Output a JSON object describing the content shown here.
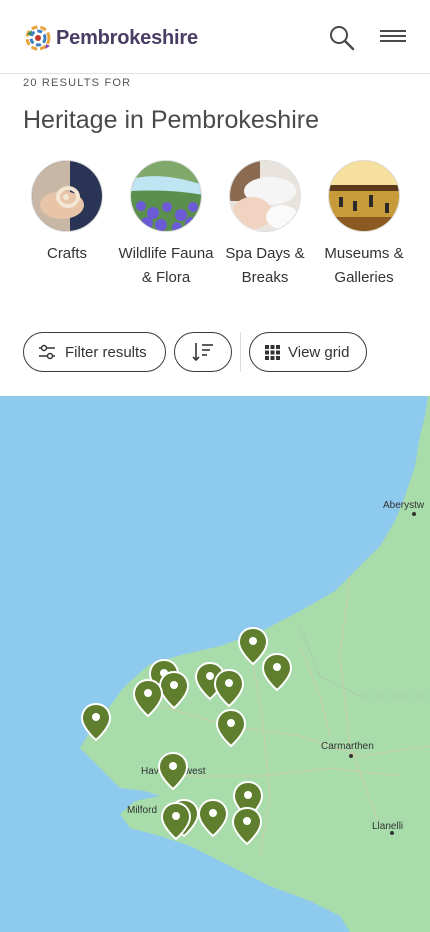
{
  "header": {
    "brand": "Pembrokeshire",
    "search_icon": "search-icon",
    "menu_icon": "hamburger-menu-icon"
  },
  "results": {
    "count_text": "20 RESULTS FOR",
    "title": "Heritage in Pembrokeshire"
  },
  "categories": [
    {
      "label": "Crafts",
      "image": "crafts-photo"
    },
    {
      "label": "Wildlife Fauna & Flora",
      "image": "wildlife-photo"
    },
    {
      "label": "Spa Days & Breaks",
      "image": "spa-photo"
    },
    {
      "label": "Museums & Galleries",
      "image": "museum-photo"
    }
  ],
  "toolbar": {
    "filter_label": "Filter results",
    "filter_icon": "sliders-icon",
    "sort_icon": "sort-icon",
    "view_label": "View grid",
    "view_icon": "grid-icon"
  },
  "map": {
    "places": [
      "Aberystw",
      "Carmarthen",
      "Haverfordwest",
      "Milford",
      "Llanelli"
    ],
    "marker_color": "#5f7f2e",
    "sea_color": "#8ec9ee",
    "land_color": "#a8dcab"
  }
}
